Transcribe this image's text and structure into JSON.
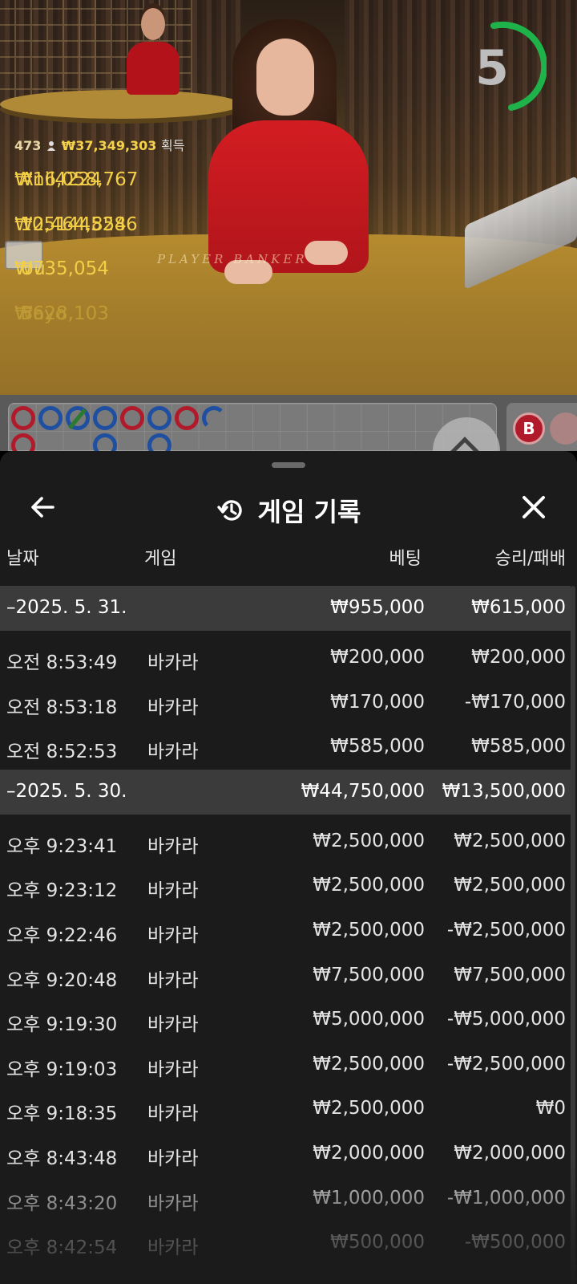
{
  "timer": {
    "value": "5",
    "progress": 0.3,
    "color": "#1fb14a"
  },
  "winners": {
    "count": "473",
    "total": "₩37,349,303",
    "gain_label": "획득",
    "rows": [
      {
        "amount": "₩16,058,767",
        "name": "Anil4224"
      },
      {
        "amount": "₩2,464,854",
        "name": "1051445286"
      },
      {
        "amount": "₩735,054",
        "name": "Uu"
      },
      {
        "amount": "₩628,103",
        "name": "Bayo"
      }
    ]
  },
  "table_text": "PLAYER   BANKER",
  "bead_road": {
    "beads": [
      "B",
      "P",
      "T",
      "P",
      "B",
      "P",
      "B",
      "P"
    ],
    "second_row": [
      "B",
      "",
      "",
      "P",
      "",
      "P",
      "",
      ""
    ]
  },
  "side_badge": "B",
  "sheet": {
    "title": "게임 기록",
    "back_icon": "arrow-left-icon",
    "close_icon": "close-icon",
    "history_icon": "history-icon",
    "columns": {
      "date": "날짜",
      "game": "게임",
      "bet": "베팅",
      "result": "승리/패배"
    },
    "groups": [
      {
        "date": "–2025. 5. 31.",
        "bet": "₩955,000",
        "result": "₩615,000",
        "rows": [
          {
            "time": "오전 8:53:49",
            "game": "바카라",
            "bet": "₩200,000",
            "result": "₩200,000"
          },
          {
            "time": "오전 8:53:18",
            "game": "바카라",
            "bet": "₩170,000",
            "result": "-₩170,000"
          },
          {
            "time": "오전 8:52:53",
            "game": "바카라",
            "bet": "₩585,000",
            "result": "₩585,000"
          }
        ]
      },
      {
        "date": "–2025. 5. 30.",
        "bet": "₩44,750,000",
        "result": "₩13,500,000",
        "rows": [
          {
            "time": "오후 9:23:41",
            "game": "바카라",
            "bet": "₩2,500,000",
            "result": "₩2,500,000"
          },
          {
            "time": "오후 9:23:12",
            "game": "바카라",
            "bet": "₩2,500,000",
            "result": "₩2,500,000"
          },
          {
            "time": "오후 9:22:46",
            "game": "바카라",
            "bet": "₩2,500,000",
            "result": "-₩2,500,000"
          },
          {
            "time": "오후 9:20:48",
            "game": "바카라",
            "bet": "₩7,500,000",
            "result": "₩7,500,000"
          },
          {
            "time": "오후 9:19:30",
            "game": "바카라",
            "bet": "₩5,000,000",
            "result": "-₩5,000,000"
          },
          {
            "time": "오후 9:19:03",
            "game": "바카라",
            "bet": "₩2,500,000",
            "result": "-₩2,500,000"
          },
          {
            "time": "오후 9:18:35",
            "game": "바카라",
            "bet": "₩2,500,000",
            "result": "₩0"
          },
          {
            "time": "오후 8:43:48",
            "game": "바카라",
            "bet": "₩2,000,000",
            "result": "₩2,000,000"
          },
          {
            "time": "오후 8:43:20",
            "game": "바카라",
            "bet": "₩1,000,000",
            "result": "-₩1,000,000"
          },
          {
            "time": "오후 8:42:54",
            "game": "바카라",
            "bet": "₩500,000",
            "result": "-₩500,000"
          }
        ]
      }
    ]
  }
}
